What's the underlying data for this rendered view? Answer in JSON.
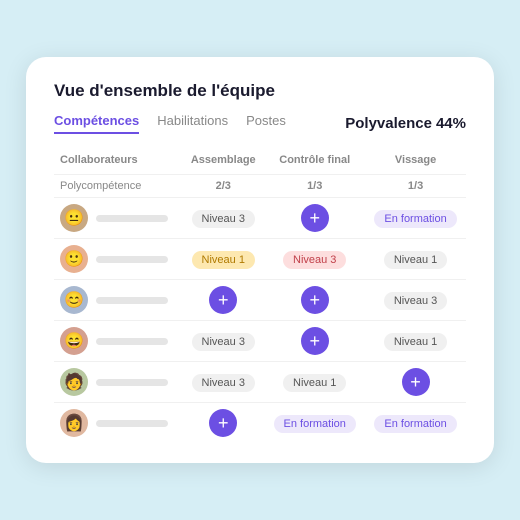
{
  "card": {
    "title": "Vue d'ensemble de l'équipe",
    "tabs": [
      {
        "label": "Compétences",
        "active": true
      },
      {
        "label": "Habilitations",
        "active": false
      },
      {
        "label": "Postes",
        "active": false
      }
    ],
    "polyvalence_label": "Polyvalence",
    "polyvalence_value": "44%",
    "columns": [
      "Collaborateurs",
      "Assemblage",
      "Contrôle final",
      "Vissage"
    ],
    "polycomp_row": {
      "label": "Polycompétence",
      "values": [
        "2/3",
        "1/3",
        "1/3"
      ]
    },
    "rows": [
      {
        "avatar_emoji": "👤",
        "cells": [
          {
            "type": "badge",
            "style": "gray",
            "text": "Niveau 3"
          },
          {
            "type": "plus"
          },
          {
            "type": "badge",
            "style": "purple-light",
            "text": "En formation"
          }
        ]
      },
      {
        "avatar_emoji": "👤",
        "cells": [
          {
            "type": "badge",
            "style": "yellow",
            "text": "Niveau 1"
          },
          {
            "type": "badge",
            "style": "pink",
            "text": "Niveau 3"
          },
          {
            "type": "badge",
            "style": "gray",
            "text": "Niveau 1"
          }
        ]
      },
      {
        "avatar_emoji": "👤",
        "cells": [
          {
            "type": "plus"
          },
          {
            "type": "plus"
          },
          {
            "type": "badge",
            "style": "gray",
            "text": "Niveau 3"
          }
        ]
      },
      {
        "avatar_emoji": "👤",
        "cells": [
          {
            "type": "badge",
            "style": "gray",
            "text": "Niveau 3"
          },
          {
            "type": "plus"
          },
          {
            "type": "badge",
            "style": "gray",
            "text": "Niveau 1"
          }
        ]
      },
      {
        "avatar_emoji": "👤",
        "cells": [
          {
            "type": "badge",
            "style": "gray",
            "text": "Niveau 3"
          },
          {
            "type": "badge",
            "style": "gray",
            "text": "Niveau 1"
          },
          {
            "type": "plus"
          }
        ]
      },
      {
        "avatar_emoji": "👤",
        "cells": [
          {
            "type": "plus"
          },
          {
            "type": "badge",
            "style": "purple-light",
            "text": "En formation"
          },
          {
            "type": "badge",
            "style": "purple-light",
            "text": "En formation"
          }
        ]
      }
    ]
  }
}
